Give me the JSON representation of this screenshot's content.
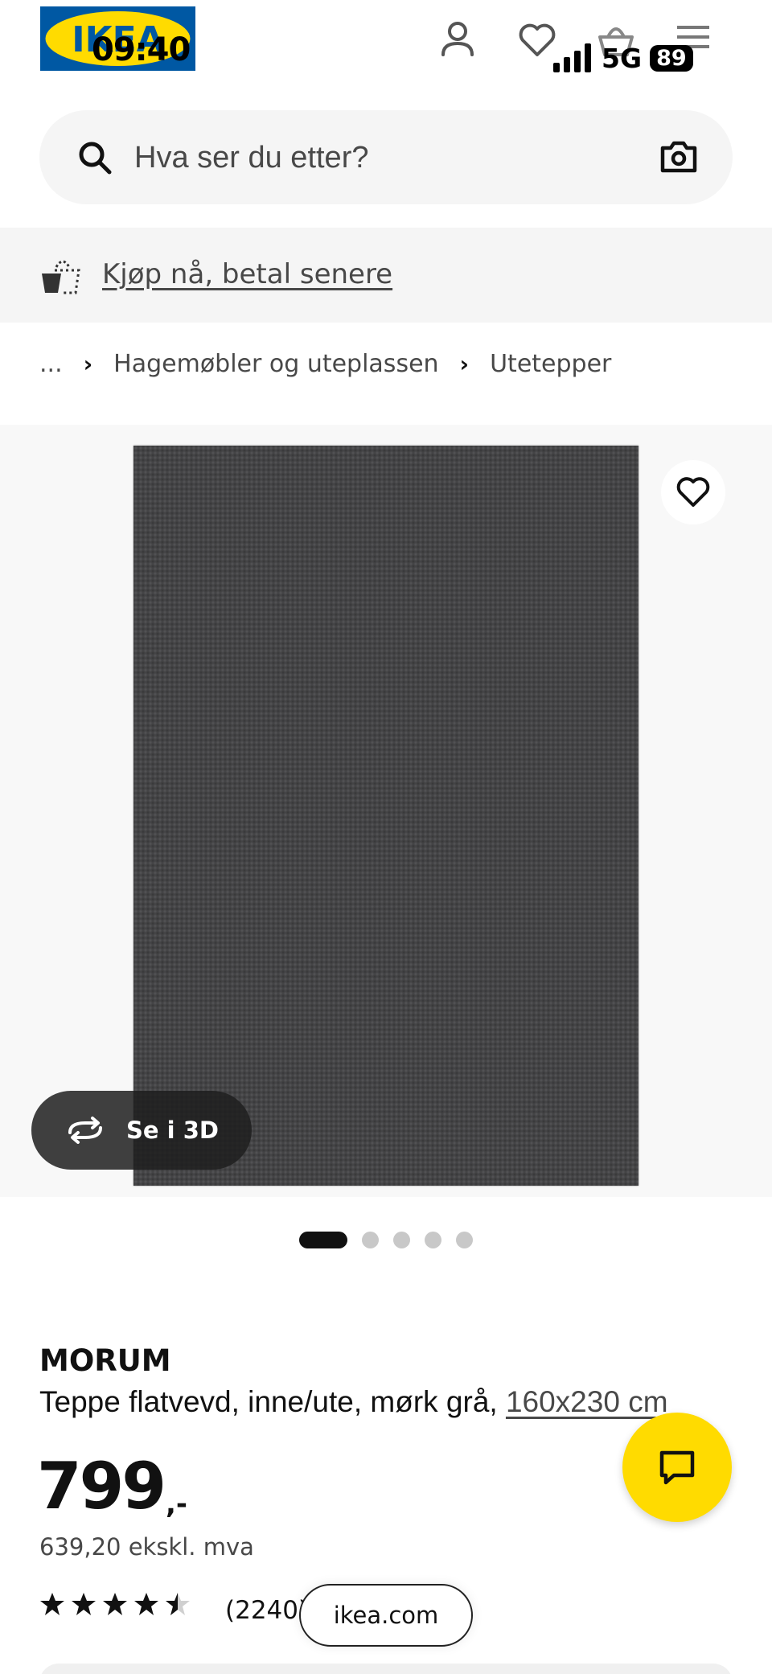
{
  "status_bar": {
    "time": "09:40",
    "network": "5G",
    "battery": "89"
  },
  "header": {
    "logo_text": "IKEA",
    "icons": [
      "profile-icon",
      "heart-icon",
      "shopping-bag-icon",
      "hamburger-menu-icon"
    ]
  },
  "search": {
    "placeholder": "Hva ser du etter?"
  },
  "promo": {
    "link_text": "Kjøp nå, betal senere"
  },
  "breadcrumb": {
    "ellipsis": "...",
    "items": [
      "Hagemøbler og uteplassen",
      "Utetepper"
    ]
  },
  "gallery": {
    "see_3d_label": "Se i 3D",
    "image_count": 5,
    "active_index": 0
  },
  "product": {
    "name": "MORUM",
    "description": "Teppe flatvevd, inne/ute, mørk grå,",
    "size": "160x230 cm",
    "price_integer": "799",
    "price_decimal": ",-",
    "price_excl_vat": "639,20 ekskl. mva",
    "rating_value": 4.5,
    "rating_max": 5,
    "review_count": "(2240)"
  },
  "browser": {
    "url": "ikea.com"
  },
  "colors": {
    "ikea_blue": "#0058a3",
    "ikea_yellow": "#ffdb00",
    "rug_grey": "#444446"
  }
}
